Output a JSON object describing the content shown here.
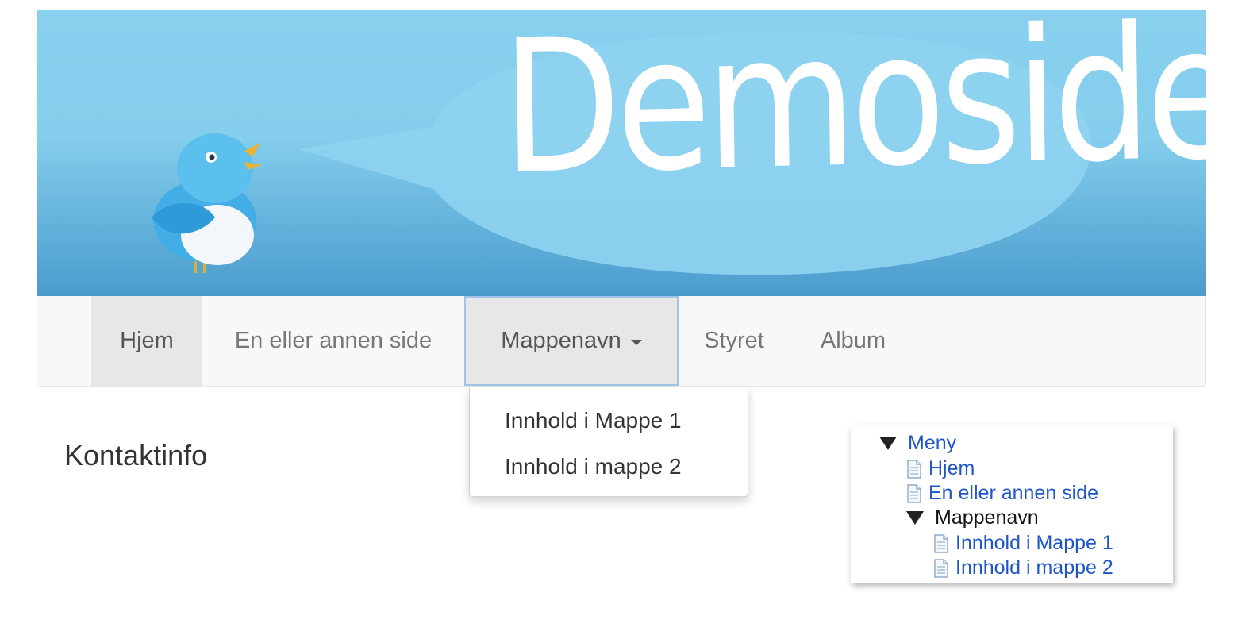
{
  "banner": {
    "brand_text": "Demoside",
    "colors": {
      "sky_top": "#88d0ee",
      "sky_bottom": "#4b9bcd",
      "bubble": "#8dd2ef",
      "text": "#ffffff"
    }
  },
  "nav": {
    "items": [
      {
        "label": "Hjem",
        "state": "active"
      },
      {
        "label": "En eller annen side",
        "state": "normal"
      },
      {
        "label": "Mappenavn",
        "state": "open",
        "has_caret": true
      },
      {
        "label": "Styret",
        "state": "normal"
      },
      {
        "label": "Album",
        "state": "normal"
      }
    ],
    "dropdown": [
      {
        "label": "Innhold i Mappe 1"
      },
      {
        "label": "Innhold i mappe 2"
      }
    ]
  },
  "main": {
    "heading": "Kontaktinfo"
  },
  "tree": {
    "root_label": "Meny",
    "items": [
      {
        "label": "Hjem",
        "type": "page",
        "icon": "page-icon"
      },
      {
        "label": "En eller annen side",
        "type": "page",
        "icon": "page-icon"
      },
      {
        "label": "Mappenavn",
        "type": "folder",
        "icon": "expanded-triangle-icon"
      },
      {
        "label": "Innhold i Mappe 1",
        "type": "page",
        "icon": "page-icon"
      },
      {
        "label": "Innhold i mappe 2",
        "type": "page",
        "icon": "page-icon"
      }
    ],
    "colors": {
      "link": "#1f55c9",
      "text": "#111111"
    }
  }
}
